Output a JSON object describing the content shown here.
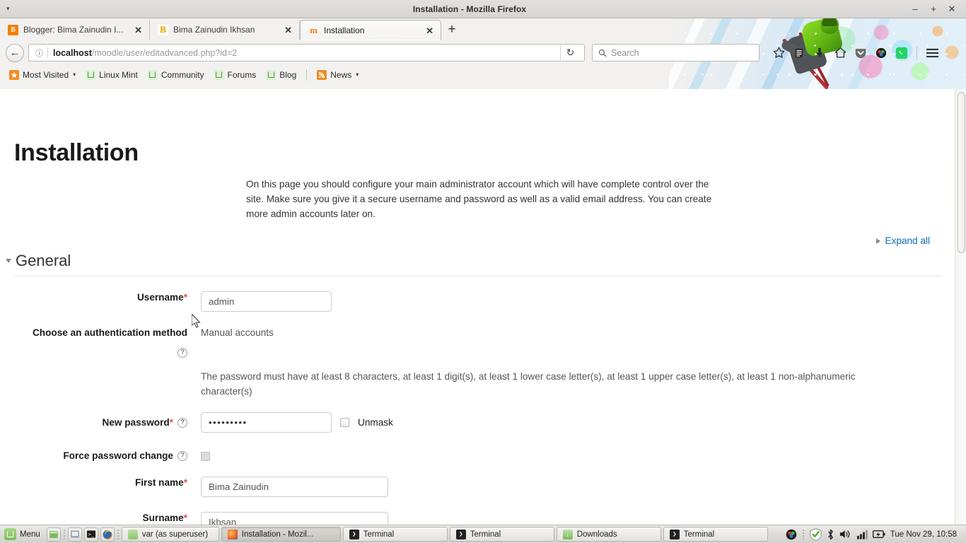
{
  "window": {
    "title": "Installation - Mozilla Firefox",
    "minimize": "–",
    "maximize": "+",
    "close": "✕",
    "menu_caret": "▾"
  },
  "tabs": [
    {
      "label": "Blogger: Bima Zainudin I...",
      "favicon": "blogger-icon",
      "favicon_glyph": "B",
      "close": "✕",
      "active": false
    },
    {
      "label": "Bima Zainudin Ikhsan",
      "favicon": "bzi-icon",
      "favicon_glyph": "B",
      "close": "✕",
      "active": false
    },
    {
      "label": "Installation",
      "favicon": "moodle-icon",
      "favicon_glyph": "m",
      "close": "✕",
      "active": true
    }
  ],
  "new_tab_label": "+",
  "navbar": {
    "back_glyph": "←",
    "identity_glyph": "ⓘ",
    "url_host": "localhost",
    "url_path": "/moodle/user/editadvanced.php?id=2",
    "reload_glyph": "↻",
    "search_placeholder": "Search",
    "icons": [
      {
        "name": "bookmark-star-icon",
        "glyph": "☆"
      },
      {
        "name": "reading-list-icon",
        "glyph": "▤"
      },
      {
        "name": "downloads-icon",
        "glyph": "↓"
      },
      {
        "name": "home-icon",
        "glyph": "⌂"
      },
      {
        "name": "pocket-icon",
        "glyph": "▼"
      },
      {
        "name": "colorpicker-icon",
        "glyph": "●"
      },
      {
        "name": "whatsapp-icon",
        "glyph": "✆"
      },
      {
        "name": "hamburger-menu-icon",
        "glyph": "☰"
      }
    ]
  },
  "bookmarks": [
    {
      "label": "Most Visited",
      "icon": "star-folder-icon",
      "caret": "▾"
    },
    {
      "label": "Linux Mint",
      "icon": "mint-icon",
      "caret": ""
    },
    {
      "label": "Community",
      "icon": "mint-icon",
      "caret": ""
    },
    {
      "label": "Forums",
      "icon": "mint-icon",
      "caret": ""
    },
    {
      "label": "Blog",
      "icon": "mint-icon",
      "caret": ""
    },
    {
      "label": "News",
      "icon": "rss-icon",
      "caret": "▾"
    }
  ],
  "page": {
    "title": "Installation",
    "intro": "On this page you should configure your main administrator account which will have complete control over the site. Make sure you give it a secure username and password as well as a valid email address. You can create more admin accounts later on.",
    "expand_all": "Expand all",
    "section_title": "General",
    "fields": {
      "username": {
        "label": "Username",
        "required": "*",
        "value": "admin"
      },
      "auth_method": {
        "label": "Choose an authentication method",
        "required": "",
        "value": "Manual accounts",
        "help": "?"
      },
      "password_policy": "The password must have at least 8 characters, at least 1 digit(s), at least 1 lower case letter(s), at least 1 upper case letter(s), at least 1 non-alphanumeric character(s)",
      "new_password": {
        "label": "New password",
        "required": "*",
        "value": "•••••••••",
        "help": "?",
        "unmask_label": "Unmask"
      },
      "force_password_change": {
        "label": "Force password change",
        "required": "",
        "help": "?"
      },
      "first_name": {
        "label": "First name",
        "required": "*",
        "value": "Bima Zainudin"
      },
      "surname": {
        "label": "Surname",
        "required": "*",
        "value": "Ikhsan"
      }
    }
  },
  "taskbar": {
    "menu_label": "Menu",
    "tasks": [
      {
        "label": "var (as superuser)",
        "icon": "folder-icon",
        "glyph": "",
        "active": false
      },
      {
        "label": "Installation - Mozil...",
        "icon": "firefox-icon",
        "glyph": "",
        "active": true
      },
      {
        "label": "Terminal",
        "icon": "terminal-icon",
        "glyph": "❯",
        "active": false
      },
      {
        "label": "Terminal",
        "icon": "terminal-icon",
        "glyph": "❯",
        "active": false
      },
      {
        "label": "Downloads",
        "icon": "downloads-folder-icon",
        "glyph": "↓",
        "active": false
      },
      {
        "label": "Terminal",
        "icon": "terminal-icon",
        "glyph": "❯",
        "active": false
      }
    ],
    "tray": [
      {
        "name": "colorpicker-tray-icon",
        "glyph": "◉"
      },
      {
        "name": "update-shield-icon",
        "glyph": "✓"
      },
      {
        "name": "bluetooth-icon",
        "glyph": "ᛦ"
      },
      {
        "name": "volume-icon",
        "glyph": "🔊"
      },
      {
        "name": "network-signal-icon",
        "glyph": "▃"
      },
      {
        "name": "battery-icon",
        "glyph": "▣"
      }
    ],
    "clock": "Tue Nov 29, 10:58"
  },
  "colors": {
    "accent_link": "#0f6cbf",
    "required_star": "#d9534f",
    "chrome_bg": "#f2f1ef",
    "page_bg": "#ffffff"
  }
}
